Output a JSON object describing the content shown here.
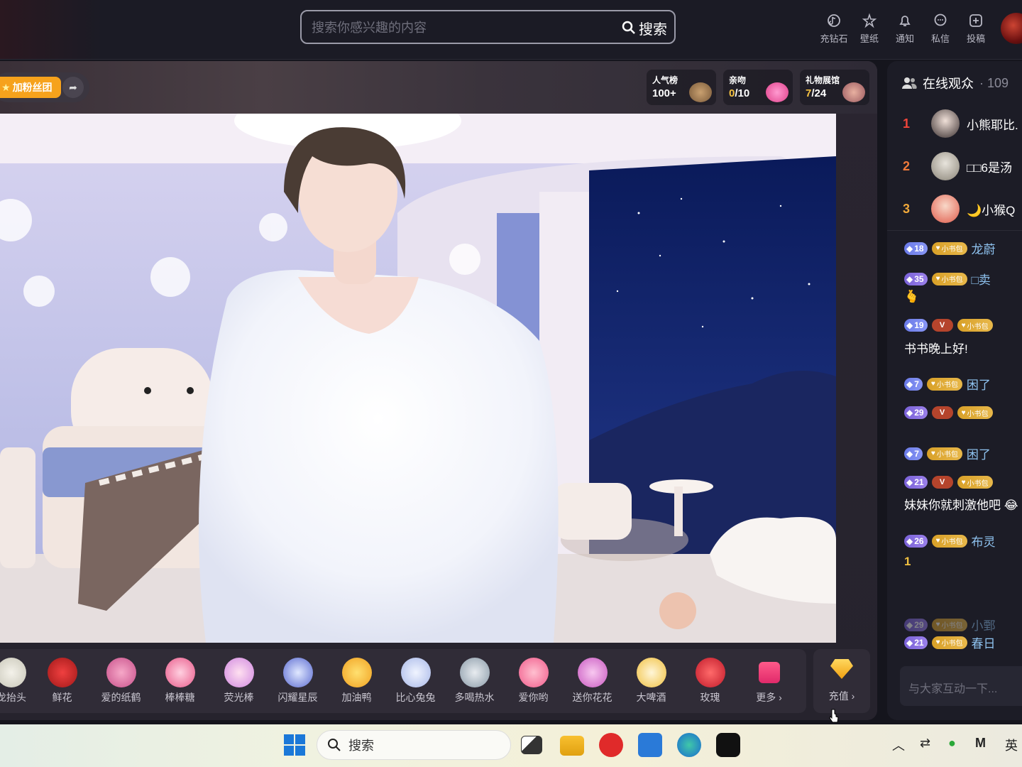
{
  "search": {
    "placeholder": "搜索你感兴趣的内容",
    "button_label": "搜索"
  },
  "top_nav": [
    {
      "label": "充钻石",
      "icon": "diamond-icon"
    },
    {
      "label": "壁纸",
      "icon": "wallpaper-icon"
    },
    {
      "label": "通知",
      "icon": "bell-icon"
    },
    {
      "label": "私信",
      "icon": "message-icon"
    },
    {
      "label": "投稿",
      "icon": "upload-icon"
    }
  ],
  "stage": {
    "fan_button": "加粉丝团",
    "stats": [
      {
        "label": "人气榜",
        "value": "100+"
      },
      {
        "label": "亲吻",
        "value": "0",
        "total": "/10"
      },
      {
        "label": "礼物展馆",
        "value": "7",
        "total": "/24"
      }
    ]
  },
  "gifts": [
    {
      "label": "龙抬头"
    },
    {
      "label": "鲜花"
    },
    {
      "label": "爱的纸鹤"
    },
    {
      "label": "棒棒糖"
    },
    {
      "label": "荧光棒"
    },
    {
      "label": "闪耀星辰"
    },
    {
      "label": "加油鸭"
    },
    {
      "label": "比心兔兔"
    },
    {
      "label": "多喝热水"
    },
    {
      "label": "爱你哟"
    },
    {
      "label": "送你花花"
    },
    {
      "label": "大啤酒"
    },
    {
      "label": "玫瑰"
    },
    {
      "label": "更多"
    }
  ],
  "recharge_label": "充值",
  "sidebar": {
    "title": "在线观众",
    "count": "109",
    "viewers": [
      {
        "rank": "1",
        "name": "小熊耶比."
      },
      {
        "rank": "2",
        "name": "□□6是汤"
      },
      {
        "rank": "3",
        "name": "🌙小猴Q"
      }
    ],
    "messages": [
      {
        "level": "18",
        "tag": "小书包",
        "nick": "龙蔚"
      },
      {
        "level": "35",
        "tag": "小书包",
        "nick": "□卖",
        "text": "🫰"
      },
      {
        "level": "19",
        "tag": "小书包",
        "v": "V",
        "text": "书书晚上好!"
      },
      {
        "level": "7",
        "tag": "小书包",
        "nick": "困了"
      },
      {
        "level": "29",
        "tag": "小书包",
        "v": "V"
      },
      {
        "level": "7",
        "tag": "小书包",
        "nick": "困了"
      },
      {
        "level": "21",
        "tag": "小书包",
        "v": "V",
        "text": "妹妹你就刺激他吧 😂"
      },
      {
        "level": "26",
        "tag": "小书包",
        "nick": "布灵",
        "text": "1"
      },
      {
        "level": "29",
        "tag": "小书包",
        "nick": "小鄄"
      },
      {
        "level": "21",
        "tag": "小书包",
        "nick": "春日"
      }
    ],
    "chat_placeholder": "与大家互动一下..."
  },
  "taskbar": {
    "search_label": "搜索",
    "ime": "英"
  }
}
